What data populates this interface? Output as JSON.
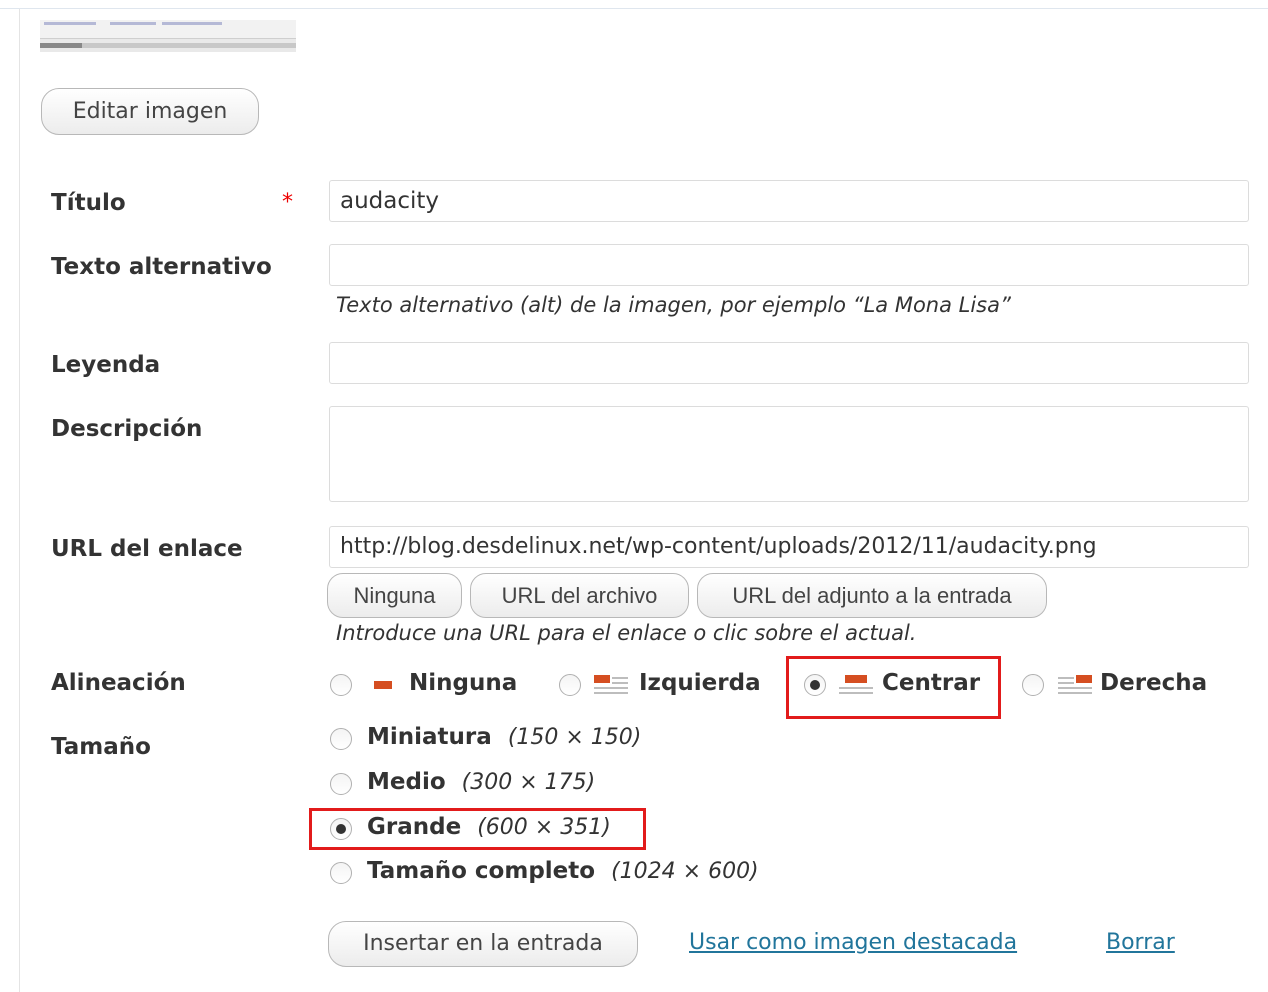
{
  "edit_button": "Editar imagen",
  "fields": {
    "title_label": "Título",
    "title_required": "*",
    "title_value": "audacity",
    "alt_label": "Texto alternativo",
    "alt_value": "",
    "alt_help": "Texto alternativo (alt) de la imagen, por ejemplo “La Mona Lisa”",
    "caption_label": "Leyenda",
    "caption_value": "",
    "description_label": "Descripción",
    "description_value": "",
    "link_label": "URL del enlace",
    "link_value": "http://blog.desdelinux.net/wp-content/uploads/2012/11/audacity.png",
    "link_buttons": [
      "Ninguna",
      "URL del archivo",
      "URL del adjunto a la entrada"
    ],
    "link_help": "Introduce una URL para el enlace o clic sobre el actual."
  },
  "alignment": {
    "label": "Alineación",
    "options": [
      "Ninguna",
      "Izquierda",
      "Centrar",
      "Derecha"
    ],
    "selected": "Centrar"
  },
  "size": {
    "label": "Tamaño",
    "options": [
      {
        "name": "Miniatura",
        "dims": "(150 × 150)"
      },
      {
        "name": "Medio",
        "dims": "(300 × 175)"
      },
      {
        "name": "Grande",
        "dims": "(600 × 351)"
      },
      {
        "name": "Tamaño completo",
        "dims": "(1024 × 600)"
      }
    ],
    "selected": "Grande"
  },
  "actions": {
    "insert": "Insertar en la entrada",
    "featured": "Usar como imagen destacada",
    "delete": "Borrar"
  },
  "colors": {
    "highlight": "#e21b1b",
    "link": "#21759b",
    "required": "#ee0000",
    "align_icon": "#d54e21"
  }
}
